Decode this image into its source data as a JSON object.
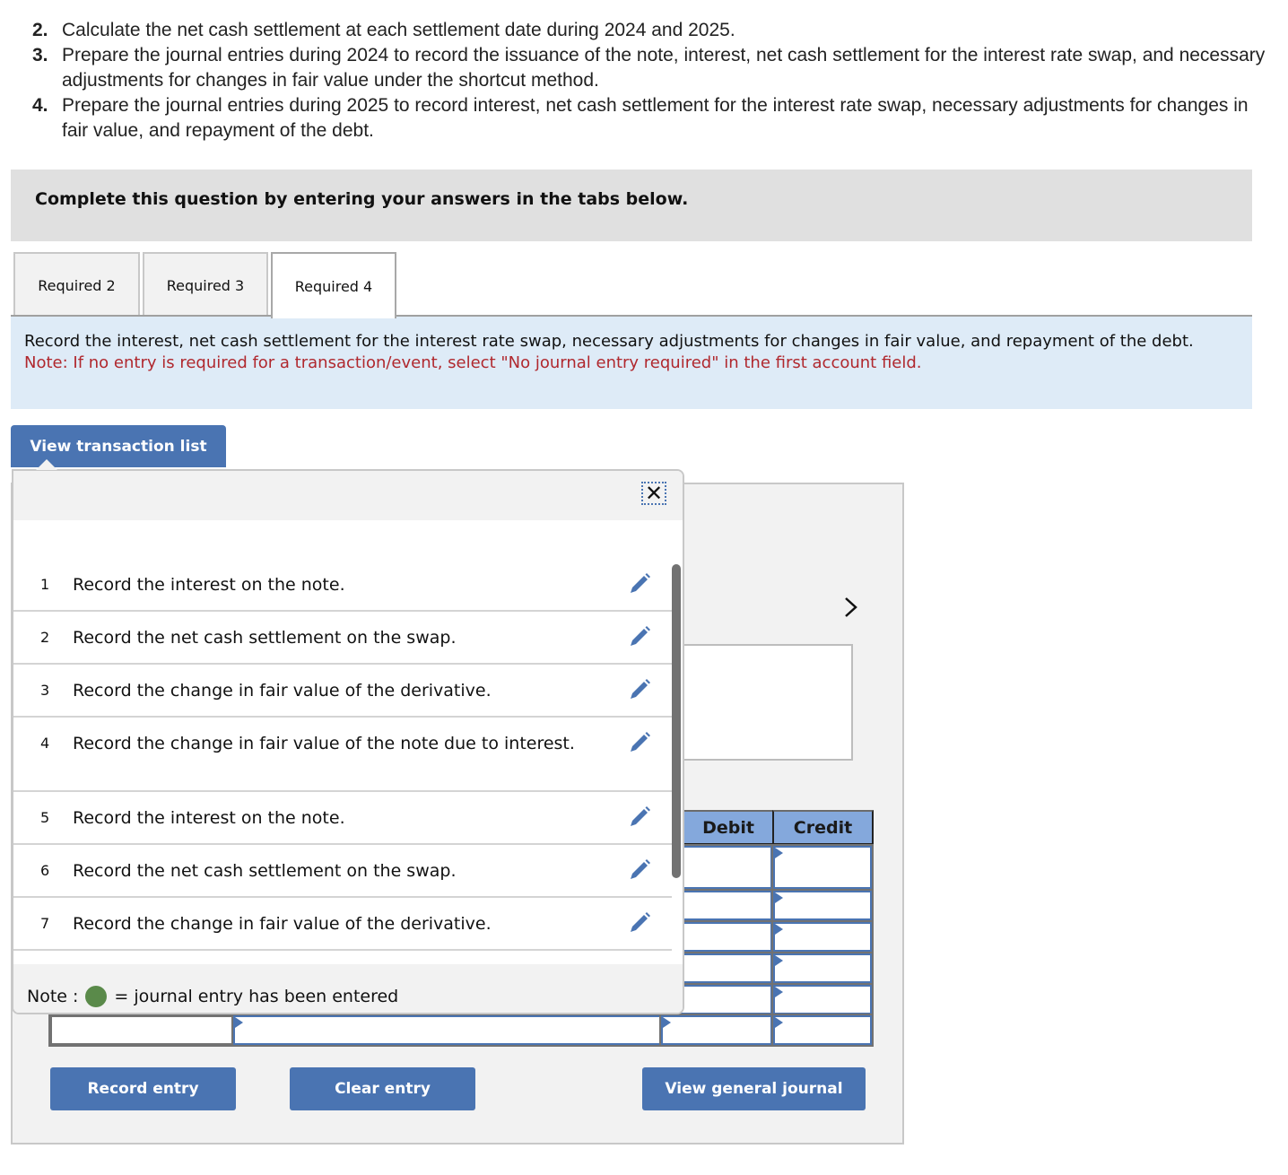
{
  "instructions": [
    {
      "num": "2.",
      "text": "Calculate the net cash settlement at each settlement date during 2024 and 2025."
    },
    {
      "num": "3.",
      "text": "Prepare the journal entries during 2024 to record the issuance of the note, interest, net cash settlement for the interest rate swap, and necessary adjustments for changes in fair value under the shortcut method."
    },
    {
      "num": "4.",
      "text": "Prepare the journal entries during 2025 to record interest, net cash settlement for the interest rate swap, necessary adjustments for changes in fair value, and repayment of the debt."
    }
  ],
  "banner": {
    "text": "Complete this question by entering your answers in the tabs below."
  },
  "tabs": [
    {
      "label": "Required 2",
      "active": false
    },
    {
      "label": "Required 3",
      "active": false
    },
    {
      "label": "Required 4",
      "active": true
    }
  ],
  "info": {
    "text": "Record the interest, net cash settlement for the interest rate swap, necessary adjustments for changes in fair value, and repayment of the debt.",
    "note": "Note: If no entry is required for a transaction/event, select \"No journal entry required\" in the first account field."
  },
  "buttons": {
    "view_transaction_list": "View transaction list",
    "record_entry": "Record entry",
    "clear_entry": "Clear entry",
    "view_general_journal": "View general journal"
  },
  "journal": {
    "headers": {
      "debit": "Debit",
      "credit": "Credit"
    },
    "next_icon": "chevron-right-icon"
  },
  "popup": {
    "close_icon": "close-icon",
    "transactions": [
      {
        "num": "1",
        "text": "Record the interest on the note."
      },
      {
        "num": "2",
        "text": "Record the net cash settlement on the swap."
      },
      {
        "num": "3",
        "text": "Record the change in fair value of the derivative."
      },
      {
        "num": "4",
        "text": "Record the change in fair value of the note due to interest."
      },
      {
        "num": "5",
        "text": "Record the interest on the note."
      },
      {
        "num": "6",
        "text": "Record the net cash settlement on the swap."
      },
      {
        "num": "7",
        "text": "Record the change in fair value of the derivative."
      }
    ],
    "footer": {
      "prefix": "Note :",
      "suffix": "= journal entry has been entered"
    }
  },
  "colors": {
    "accent": "#4a74b2",
    "note_red": "#b0282e",
    "entered_green": "#5a8a4a",
    "header_blue": "#84a8dc"
  }
}
